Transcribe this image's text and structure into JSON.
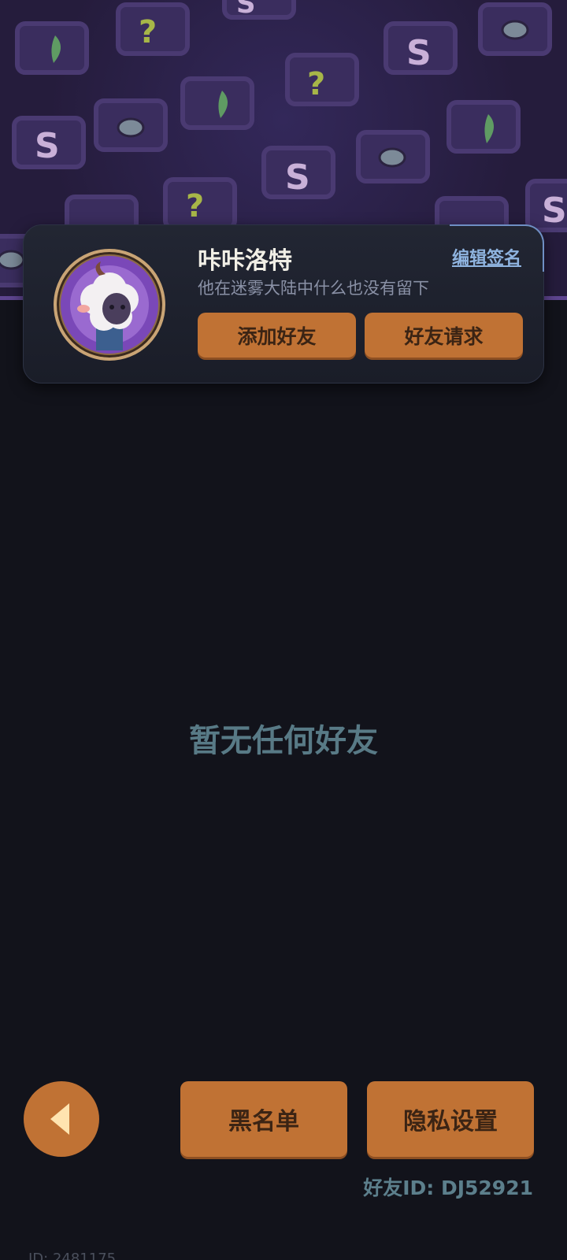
{
  "profile": {
    "nickname": "咔咔洛特",
    "edit_signature_label": "编辑签名",
    "signature": "他在迷雾大陆中什么也没有留下",
    "add_friend_label": "添加好友",
    "friend_requests_label": "好友请求"
  },
  "friends": {
    "empty_message": "暂无任何好友"
  },
  "footer": {
    "blacklist_label": "黑名单",
    "privacy_label": "隐私设置",
    "friend_id_label": "好友ID: DJ52921",
    "user_id_label": "ID: 2481175"
  },
  "icons": {
    "back": "back-arrow-icon",
    "banner_tiles": [
      "s-chest-icon",
      "question-chest-icon",
      "leaf-chest-icon",
      "eye-chest-icon"
    ]
  },
  "colors": {
    "accent_orange": "#c07234",
    "background": "#12131b",
    "banner": "#2a2040",
    "muted_teal": "#587a86"
  }
}
